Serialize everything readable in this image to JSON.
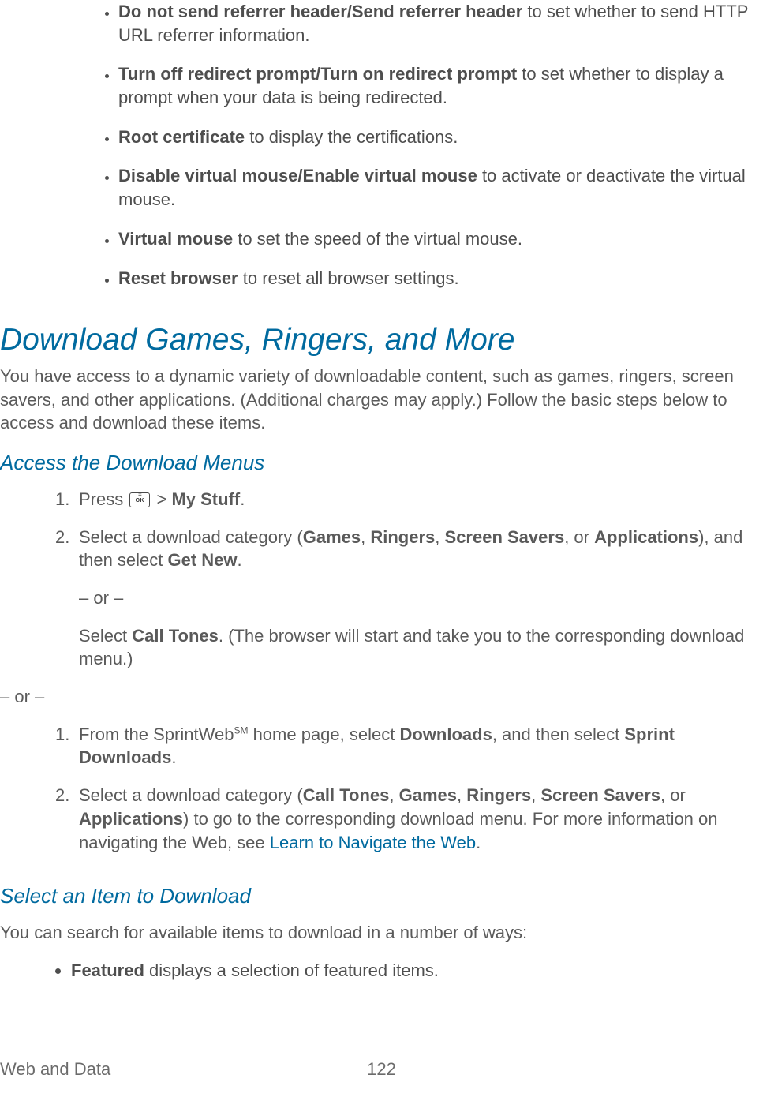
{
  "bullets_top": [
    {
      "bold": "Do not send referrer header/Send referrer header",
      "rest": " to set whether to send HTTP URL referrer information."
    },
    {
      "bold": "Turn off redirect prompt/Turn on redirect prompt",
      "rest": " to set whether to display a prompt when your data is being redirected."
    },
    {
      "bold": "Root certificate",
      "rest": " to display the certifications."
    },
    {
      "bold": "Disable virtual mouse/Enable virtual mouse",
      "rest": " to activate or deactivate the virtual mouse."
    },
    {
      "bold": "Virtual mouse",
      "rest": " to set the speed of the virtual mouse."
    },
    {
      "bold": "Reset browser",
      "rest": " to reset all browser settings."
    }
  ],
  "heading_download": "Download Games, Ringers, and More",
  "intro_download": "You have access to a dynamic variety of downloadable content, such as games, ringers, screen savers, and other applications. (Additional charges may apply.) Follow the basic steps below to access and download these items.",
  "heading_access": "Access the Download Menus",
  "listA": {
    "step1_pre": "Press ",
    "step1_gt": " > ",
    "step1_bold": "My Stuff",
    "step1_post": ".",
    "step2_a": "Select a download category (",
    "step2_b1": "Games",
    "step2_c": ", ",
    "step2_b2": "Ringers",
    "step2_b3": "Screen Savers",
    "step2_d": ", or ",
    "step2_b4": "Applications",
    "step2_e": "), and then select ",
    "step2_b5": "Get New",
    "step2_f": ".",
    "or1": "– or –",
    "step2_alt_a": "Select ",
    "step2_alt_b": "Call Tones",
    "step2_alt_c": ". (The browser will start and take you to the corresponding download menu.)"
  },
  "or_middle": "– or –",
  "listB": {
    "step1_a": "From the SprintWeb",
    "step1_sup": "SM",
    "step1_b": " home page, select ",
    "step1_bold1": "Downloads",
    "step1_c": ", and then select ",
    "step1_bold2": "Sprint Downloads",
    "step1_d": ".",
    "step2_a": "Select a download category (",
    "step2_b1": "Call Tones",
    "step2_c": ", ",
    "step2_b2": "Games",
    "step2_b3": "Ringers",
    "step2_b4": "Screen Savers",
    "step2_d": ", or ",
    "step2_b5": "Applications",
    "step2_e": ") to go to the corresponding download menu. For more information on navigating the Web, see ",
    "step2_link": "Learn to Navigate the Web",
    "step2_f": "."
  },
  "heading_select": "Select an Item to Download",
  "para_select": "You can search for available items to download in a number of ways:",
  "bullet_featured_bold": "Featured",
  "bullet_featured_rest": " displays a selection of featured items.",
  "footer_left": "Web and Data",
  "footer_page": "122"
}
